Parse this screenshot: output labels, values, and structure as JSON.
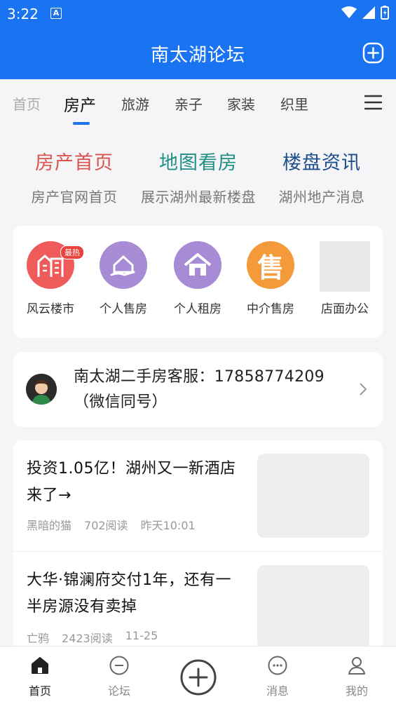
{
  "status_bar": {
    "time": "3:22",
    "badge": "A"
  },
  "header": {
    "title": "南太湖论坛",
    "action_icon": "add-circle-icon"
  },
  "tabs": [
    {
      "label": "首页",
      "state": "dim"
    },
    {
      "label": "房产",
      "state": "active"
    },
    {
      "label": "旅游",
      "state": "normal"
    },
    {
      "label": "亲子",
      "state": "normal"
    },
    {
      "label": "家装",
      "state": "normal"
    },
    {
      "label": "织里",
      "state": "normal"
    }
  ],
  "quick_links": [
    {
      "title": "房产首页",
      "subtitle": "房产官网首页",
      "color": "#d9534f"
    },
    {
      "title": "地图看房",
      "subtitle": "展示湖州最新楼盘",
      "color": "#1f8f86"
    },
    {
      "title": "楼盘资讯",
      "subtitle": "湖州地产消息",
      "color": "#1f4e8c"
    }
  ],
  "category_icons": [
    {
      "label": "风云楼市",
      "icon": "building-icon",
      "color": "#ef5b5b",
      "badge": "最热"
    },
    {
      "label": "个人售房",
      "icon": "house-hand-icon",
      "color": "#a78bd4"
    },
    {
      "label": "个人租房",
      "icon": "house-icon",
      "color": "#a78bd4"
    },
    {
      "label": "中介售房",
      "icon": "sale-icon",
      "color": "#f59a3b",
      "glyph": "售"
    },
    {
      "label": "店面办公",
      "icon": "image-placeholder"
    }
  ],
  "service": {
    "text_line1": "南太湖二手房客服：17858774209",
    "text_line2": "（微信同号）"
  },
  "articles": [
    {
      "title": "投资1.05亿！湖州又一新酒店来了→",
      "author": "黑暗的猫",
      "reads": "702阅读",
      "time": "昨天10:01"
    },
    {
      "title": "大华·锦澜府交付1年，还有一半房源没有卖掉",
      "author": "亡鸦",
      "reads": "2423阅读",
      "time": "11-25"
    }
  ],
  "bottom_nav": [
    {
      "label": "首页",
      "icon": "home-icon",
      "active": true
    },
    {
      "label": "论坛",
      "icon": "forum-icon",
      "active": false
    },
    {
      "label": "",
      "icon": "publish-plus-icon",
      "active": false
    },
    {
      "label": "消息",
      "icon": "message-icon",
      "active": false
    },
    {
      "label": "我的",
      "icon": "profile-icon",
      "active": false
    }
  ],
  "colors": {
    "primary": "#1a73f0",
    "background": "#f5f5f7"
  }
}
